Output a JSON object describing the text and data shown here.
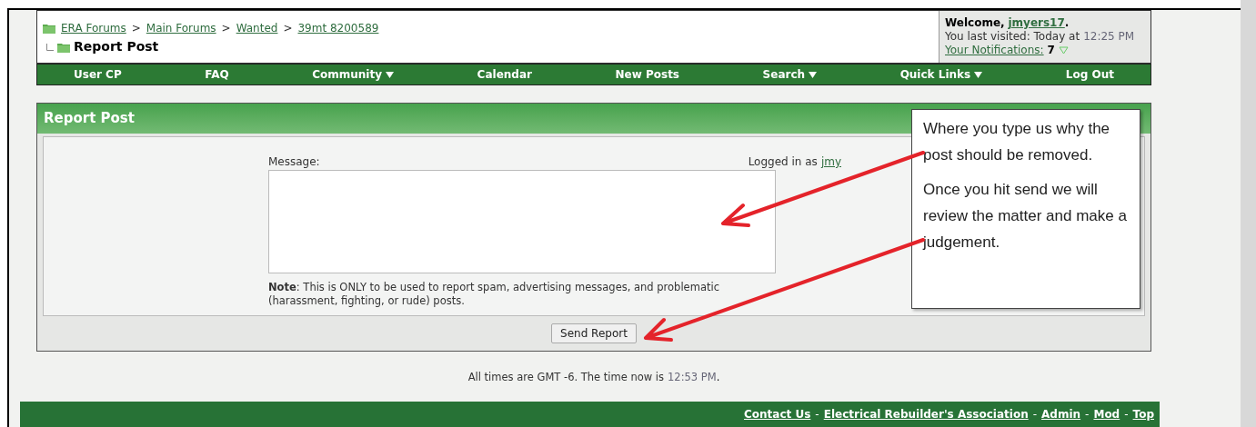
{
  "breadcrumb": {
    "links": [
      "ERA Forums",
      "Main Forums",
      "Wanted",
      "39mt 8200589"
    ],
    "separator": ">",
    "title": "Report Post"
  },
  "welcome": {
    "greeting": "Welcome,",
    "user": "jmyers17",
    "period": ".",
    "last_visited": "You last visited: Today at",
    "last_time": "12:25 PM",
    "notifications_label": "Your Notifications:",
    "notifications_count": "7"
  },
  "nav": [
    {
      "label": "User CP",
      "dropdown": false
    },
    {
      "label": "FAQ",
      "dropdown": false
    },
    {
      "label": "Community",
      "dropdown": true
    },
    {
      "label": "Calendar",
      "dropdown": false
    },
    {
      "label": "New Posts",
      "dropdown": false
    },
    {
      "label": "Search",
      "dropdown": true
    },
    {
      "label": "Quick Links",
      "dropdown": true
    },
    {
      "label": "Log Out",
      "dropdown": false
    }
  ],
  "panel": {
    "title": "Report Post",
    "message_label": "Message:",
    "logged_in_label": "Logged in as",
    "logged_in_user": "jmy",
    "note": "**Note**: This is ONLY to be used to report spam, advertising messages, and problematic (harassment, fighting, or rude) posts.",
    "button": "Send Report"
  },
  "callout": {
    "paragraphs": [
      "Where you type us why the post should be removed.",
      "Once you hit send we will review the matter and make a judgement."
    ]
  },
  "time_note": {
    "text": "All times are GMT -6. The time now is",
    "time": "12:53 PM",
    "period": "."
  },
  "footer_links": [
    "Contact Us",
    "Electrical Rebuilder's Association",
    "Admin",
    "Mod",
    "Top"
  ],
  "footer_separators": [
    "-",
    "-",
    "-",
    "-"
  ]
}
